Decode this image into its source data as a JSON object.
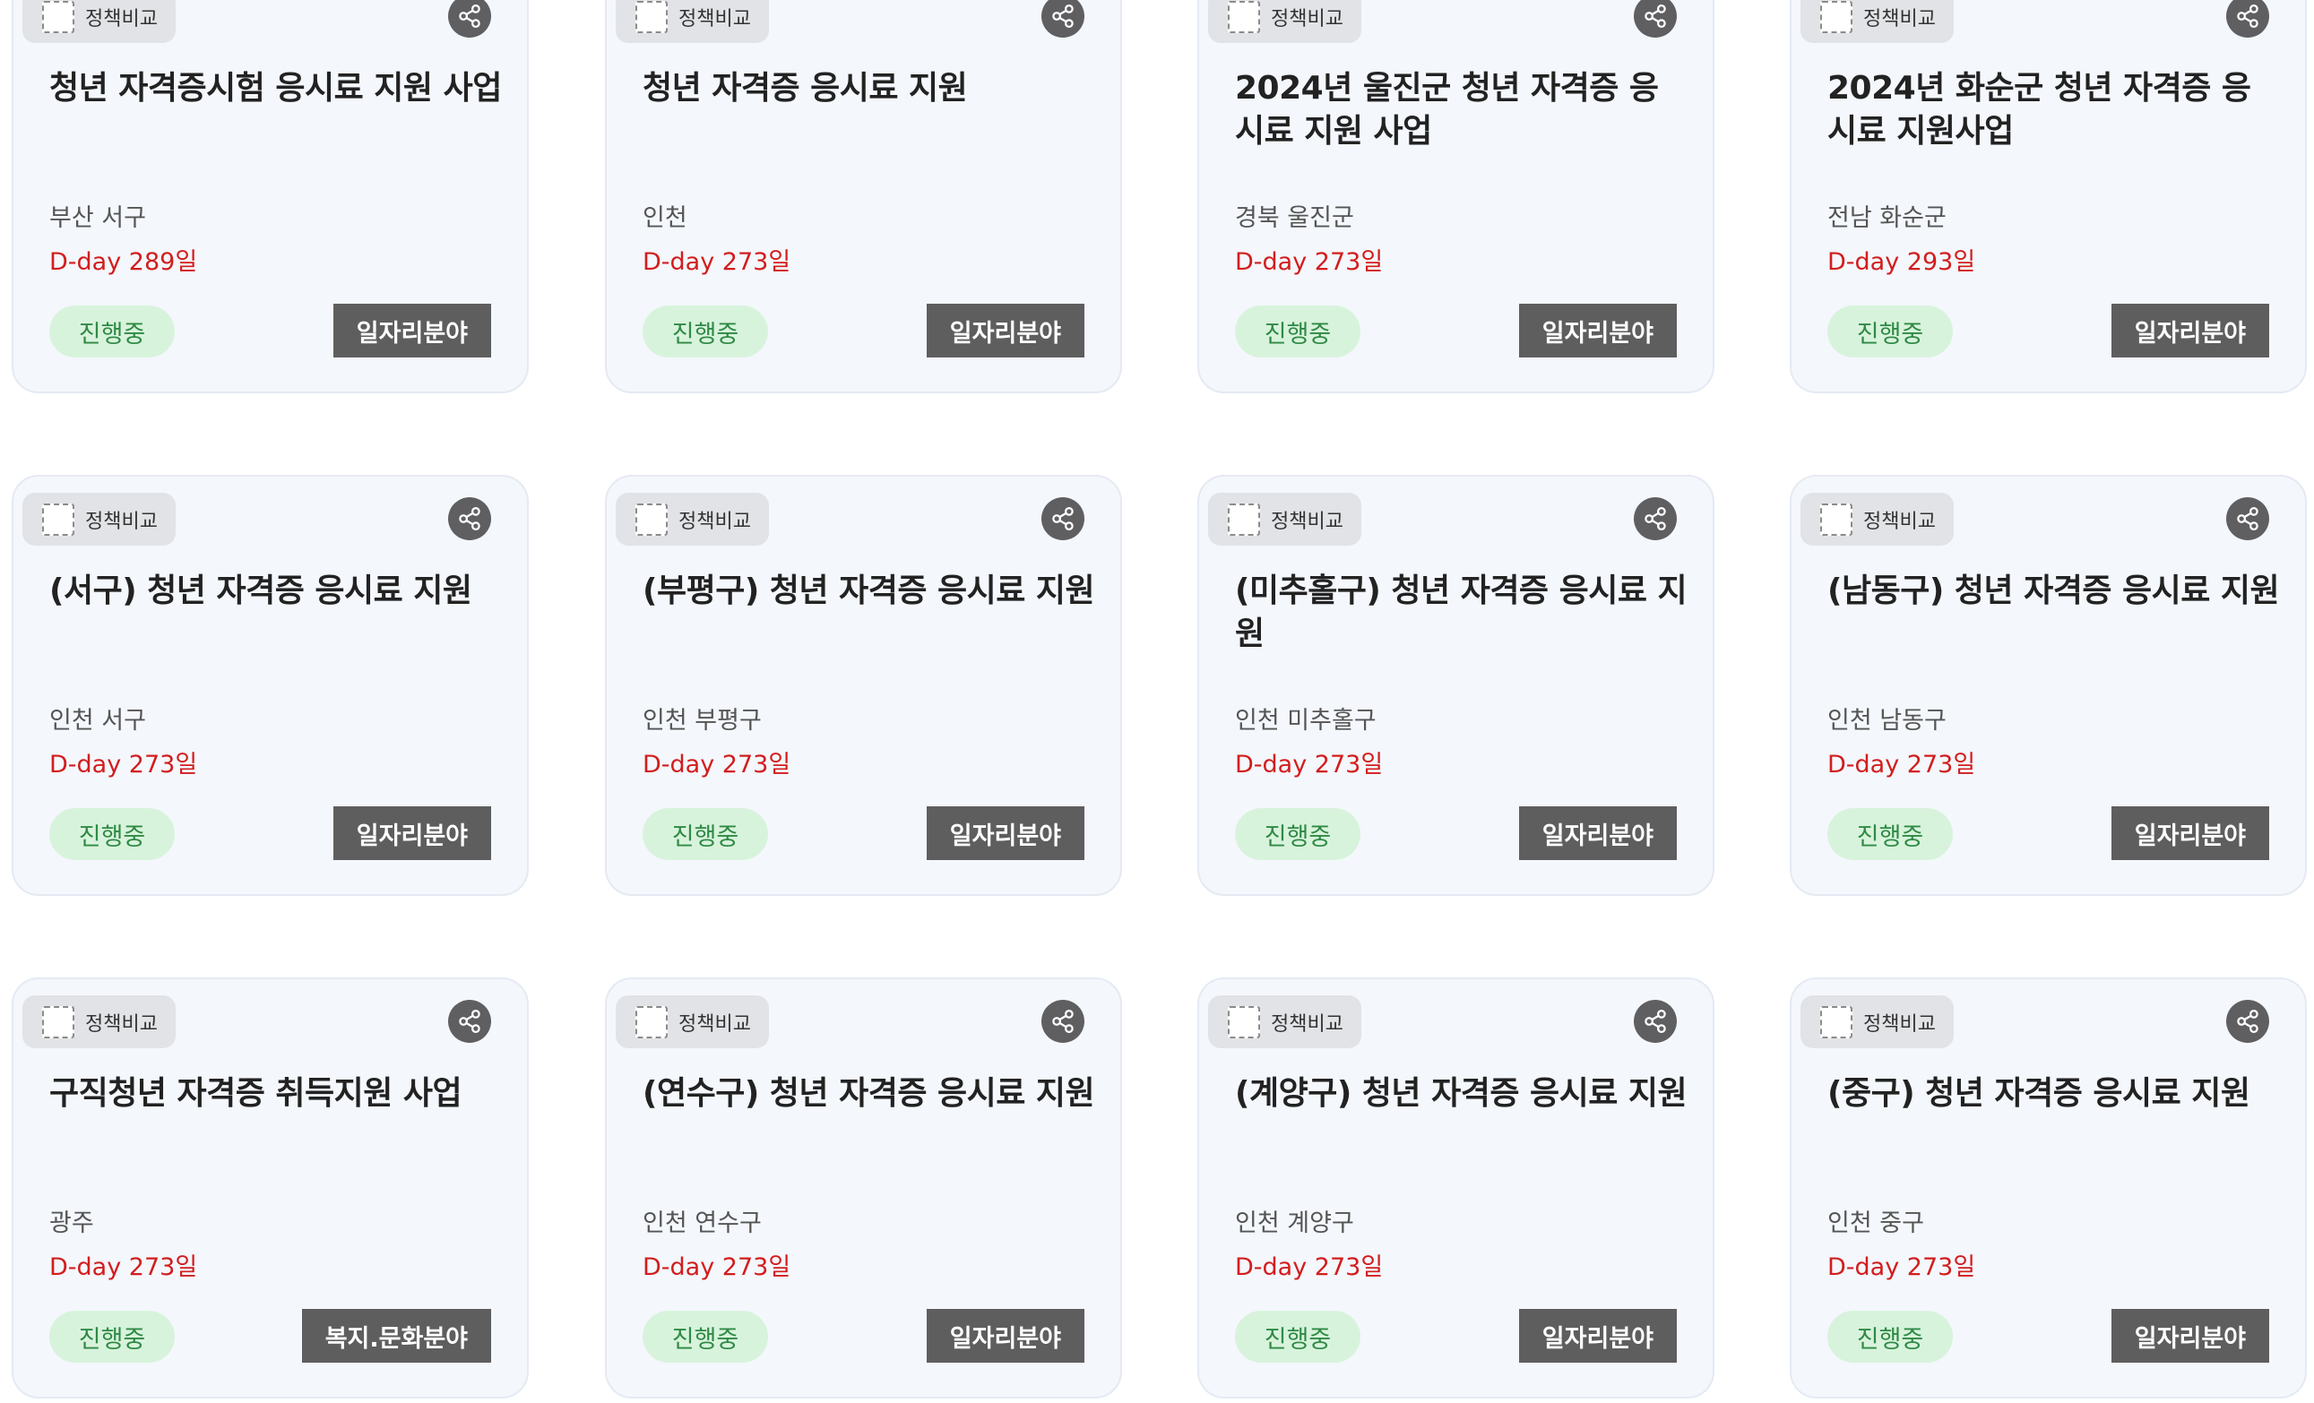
{
  "compare_label": "정책비교",
  "cards": [
    {
      "title": "청년 자격증시험 응시료 지원 사업",
      "region": "부산 서구",
      "dday": "D-day 289일",
      "status": "진행중",
      "field": "일자리분야"
    },
    {
      "title": "청년 자격증 응시료 지원",
      "region": "인천",
      "dday": "D-day 273일",
      "status": "진행중",
      "field": "일자리분야"
    },
    {
      "title": "2024년 울진군 청년 자격증 응시료 지원 사업",
      "region": "경북 울진군",
      "dday": "D-day 273일",
      "status": "진행중",
      "field": "일자리분야"
    },
    {
      "title": "2024년 화순군 청년 자격증 응시료 지원사업",
      "region": "전남 화순군",
      "dday": "D-day 293일",
      "status": "진행중",
      "field": "일자리분야"
    },
    {
      "title": "(서구) 청년 자격증 응시료 지원",
      "region": "인천 서구",
      "dday": "D-day 273일",
      "status": "진행중",
      "field": "일자리분야"
    },
    {
      "title": "(부평구) 청년 자격증 응시료 지원",
      "region": "인천 부평구",
      "dday": "D-day 273일",
      "status": "진행중",
      "field": "일자리분야"
    },
    {
      "title": "(미추홀구) 청년 자격증 응시료 지원",
      "region": "인천 미추홀구",
      "dday": "D-day 273일",
      "status": "진행중",
      "field": "일자리분야"
    },
    {
      "title": "(남동구) 청년 자격증 응시료 지원",
      "region": "인천 남동구",
      "dday": "D-day 273일",
      "status": "진행중",
      "field": "일자리분야"
    },
    {
      "title": "구직청년 자격증 취득지원 사업",
      "region": "광주",
      "dday": "D-day 273일",
      "status": "진행중",
      "field": "복지.문화분야"
    },
    {
      "title": "(연수구) 청년 자격증 응시료 지원",
      "region": "인천 연수구",
      "dday": "D-day 273일",
      "status": "진행중",
      "field": "일자리분야"
    },
    {
      "title": "(계양구) 청년 자격증 응시료 지원",
      "region": "인천 계양구",
      "dday": "D-day 273일",
      "status": "진행중",
      "field": "일자리분야"
    },
    {
      "title": "(중구) 청년 자격증 응시료 지원",
      "region": "인천 중구",
      "dday": "D-day 273일",
      "status": "진행중",
      "field": "일자리분야"
    }
  ],
  "colors": {
    "card_bg": "#f4f7fc",
    "dday": "#d21d1d",
    "status_bg": "#d8f3dc",
    "status_text": "#2f8a45",
    "field_bg": "#5e5e5e"
  },
  "icons": {
    "share": "share-icon",
    "checkbox": "checkbox-icon"
  }
}
